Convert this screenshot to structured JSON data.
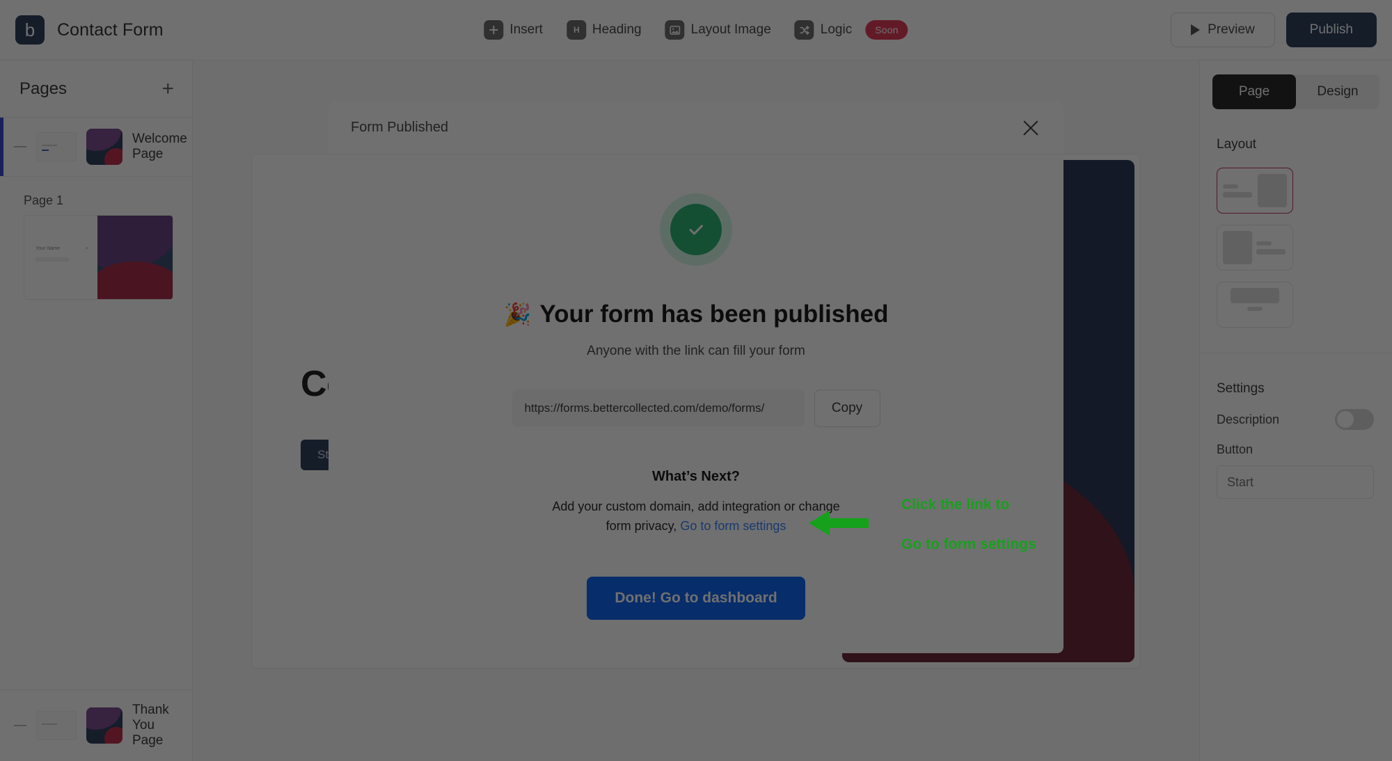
{
  "topbar": {
    "logo_letter": "b",
    "form_title": "Contact Form",
    "tools": [
      {
        "label": "Insert",
        "icon": "plus-icon"
      },
      {
        "label": "Heading",
        "icon": "heading-icon"
      },
      {
        "label": "Layout Image",
        "icon": "image-icon"
      },
      {
        "label": "Logic",
        "icon": "shuffle-icon",
        "badge": "Soon"
      }
    ],
    "preview_label": "Preview",
    "publish_label": "Publish"
  },
  "sidebar": {
    "title": "Pages",
    "add_label": "+",
    "welcome_page_label": "Welcome Page",
    "group_label": "Page 1",
    "page_card": {
      "field_label": "Your Name",
      "required_mark": "*"
    },
    "thankyou_page_label": "Thank You Page"
  },
  "canvas": {
    "heading": "Contact",
    "start_button": "Start"
  },
  "rightpanel": {
    "tabs": [
      {
        "label": "Page",
        "active": true
      },
      {
        "label": "Design",
        "active": false
      }
    ],
    "layout_title": "Layout",
    "settings_title": "Settings",
    "description_label": "Description",
    "description_toggle": "off",
    "button_label": "Button",
    "button_value": "",
    "button_placeholder": "Start",
    "selected_layout_accent": "#b5395b"
  },
  "modal": {
    "header_title": "Form Published",
    "close_icon": "close-icon",
    "success_icon": "check-icon",
    "success_color": "#2fb574",
    "emoji": "🎉",
    "heading": "Your form has been published",
    "subtitle": "Anyone with the link can fill your form",
    "url_value": "https://forms.bettercollected.com/demo/forms/",
    "url_placeholder": "https://forms.bettercollected.com/demo/forms/",
    "copy_label": "Copy",
    "whats_next_title": "What’s Next?",
    "next_text": "Add your custom domain, add integration or change form privacy, ",
    "next_link": "Go to form settings",
    "done_label": "Done! Go to dashboard"
  },
  "annotation": {
    "color": "#16a11c",
    "line1": "Click the link to",
    "line2": "Go to form settings",
    "arrow_icon": "left-arrow-icon"
  }
}
